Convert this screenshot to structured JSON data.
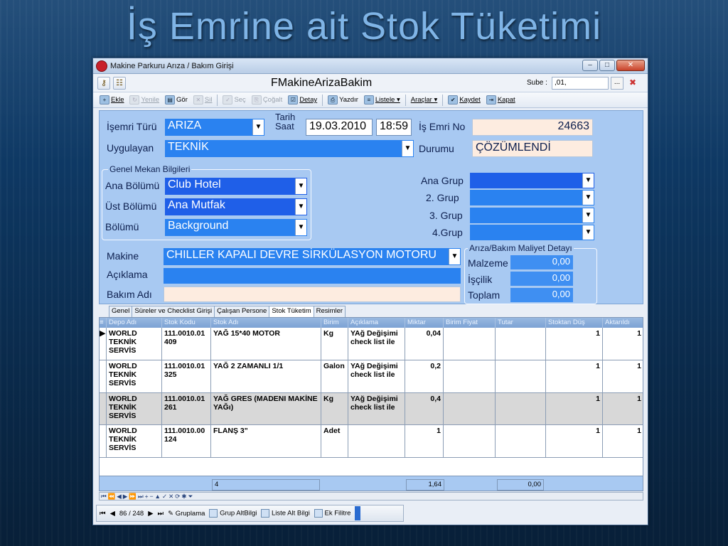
{
  "slide_title": "İş Emrine ait Stok Tüketimi",
  "window": {
    "title": "Makine Parkuru Arıza / Bakım Girişi",
    "controls": [
      "–",
      "□",
      "✕"
    ]
  },
  "formbar": {
    "form_name": "FMakineArizaBakim",
    "sube_label": "Sube :",
    "sube_value": ",01,",
    "sube_button": "..."
  },
  "toolbar": {
    "ekle": "Ekle",
    "yenile": "Yenile",
    "gor": "Gör",
    "sil": "Sil",
    "sec": "Seç",
    "cogalt": "Çoğalt",
    "detay": "Detay",
    "yazdir": "Yazdır",
    "listele": "Listele ▾",
    "araclar": "Araçlar ▾",
    "kaydet": "Kaydet",
    "kapat": "Kapat"
  },
  "form": {
    "isemri_turu_label": "İşemri Türü",
    "isemri_turu": "ARIZA",
    "tarih_label": "Tarih",
    "saat_label": "Saat",
    "tarih": "19.03.2010",
    "saat": "18:59",
    "is_emri_no_label": "İş Emri No",
    "is_emri_no": "24663",
    "uygulayan_label": "Uygulayan",
    "uygulayan": "TEKNİK",
    "durumu_label": "Durumu",
    "durumu": "ÇÖZÜMLENDİ",
    "genel_mekan_title": "Genel Mekan Bilgileri",
    "ana_bolumu_label": "Ana Bölümü",
    "ana_bolumu": "Club Hotel",
    "ust_bolumu_label": "Üst Bölümü",
    "ust_bolumu": "Ana Mutfak",
    "bolumu_label": "Bölümü",
    "bolumu": "Background",
    "ana_grup_label": "Ana Grup",
    "grup2_label": "2.  Grup",
    "grup3_label": "3. Grup",
    "grup4_label": "4.Grup",
    "makine_label": "Makine",
    "makine": "CHILLER KAPALI DEVRE SİRKÜLASYON MOTORU",
    "aciklama_label": "Açıklama",
    "bakim_adi_label": "Bakım Adı",
    "maliyet_title": "Arıza/Bakım Maliyet Detayı",
    "malzeme_label": "Malzeme",
    "malzeme": "0,00",
    "iscilik_label": "İşçilik",
    "iscilik": "0,00",
    "toplam_label": "Toplam",
    "toplam": "0,00"
  },
  "tabs": [
    "Genel",
    "Süreler ve Checklist Girişi",
    "Çalışan Persone",
    "Stok Tüketim",
    "Resimler"
  ],
  "grid": {
    "columns": [
      "Depo Adı",
      "Stok Kodu",
      "Stok Adı",
      "Birim",
      "Açıklama",
      "Miktar",
      "Birim Fiyat",
      "Tutar",
      "Stoktan Düş",
      "Aktarıldı"
    ],
    "rows": [
      {
        "depo": "WORLD TEKNİK SERVİS",
        "kod": "111.0010.01 409",
        "ad": "YAĞ 15*40 MOTOR",
        "birim": "Kg",
        "aciklama": "YAğ Değişimi check list ile",
        "miktar": "0,04",
        "birim_fiyat": "",
        "tutar": "",
        "stoktan": "1",
        "aktarildi": "1"
      },
      {
        "depo": "WORLD TEKNİK SERVİS",
        "kod": "111.0010.01 325",
        "ad": "YAĞ 2 ZAMANLI 1/1",
        "birim": "Galon",
        "aciklama": "YAğ Değişimi check list ile",
        "miktar": "0,2",
        "birim_fiyat": "",
        "tutar": "",
        "stoktan": "1",
        "aktarildi": "1"
      },
      {
        "depo": "WORLD TEKNİK SERVİS",
        "kod": "111.0010.01 261",
        "ad": "YAĞ GRES (MADENI MAKİNE YAĞı)",
        "birim": "Kg",
        "aciklama": "YAğ Değişimi check list ile",
        "miktar": "0,4",
        "birim_fiyat": "",
        "tutar": "",
        "stoktan": "1",
        "aktarildi": "1"
      },
      {
        "depo": "WORLD TEKNİK SERVİS",
        "kod": "111.0010.00 124",
        "ad": "FLANŞ 3\"",
        "birim": "Adet",
        "aciklama": "",
        "miktar": "1",
        "birim_fiyat": "",
        "tutar": "",
        "stoktan": "1",
        "aktarildi": "1"
      }
    ],
    "footer_count": "4",
    "footer_miktar": "1,64",
    "footer_tutar": "0,00"
  },
  "statusbar": {
    "record": "86 / 248",
    "gruplama": "Gruplama",
    "grup_altbilgi": "Grup AltBilgi",
    "liste_alt_bilgi": "Liste Alt Bilgi",
    "ek_filitre": "Ek Filitre"
  }
}
